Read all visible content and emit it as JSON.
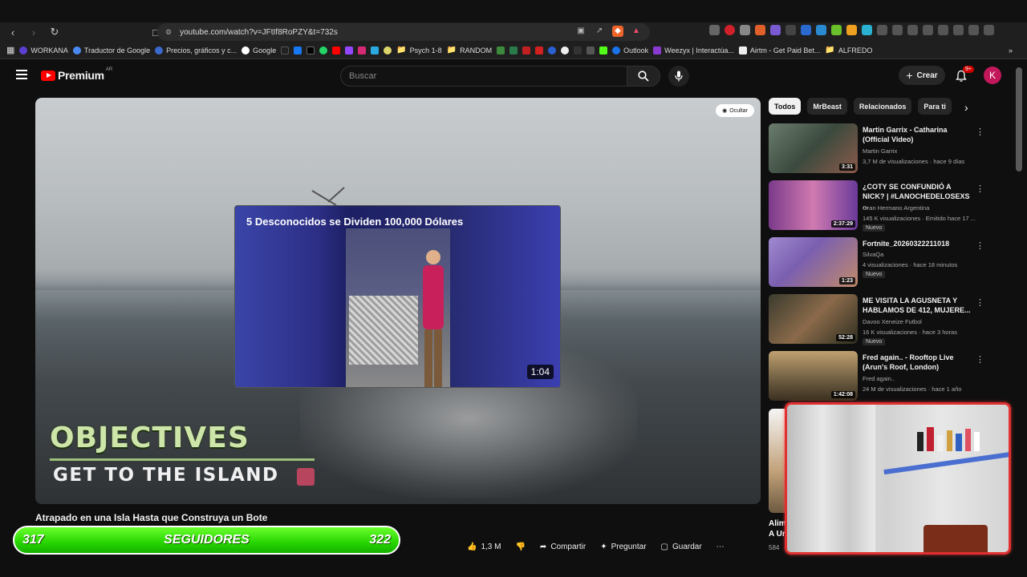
{
  "browser": {
    "url": "youtube.com/watch?v=JFtIf8RoPZY&t=732s",
    "bookmarks": [
      "WORKANA",
      "Traductor de Google",
      "Precios, gráficos y c...",
      "Google",
      "Psych 1-8",
      "RANDOM",
      "Outlook",
      "Weezyx | Interactúa...",
      "Airtm - Get Paid Bet...",
      "ALFREDO"
    ]
  },
  "masthead": {
    "logo_text": "Premium",
    "country": "AR",
    "search_placeholder": "Buscar",
    "create_label": "Crear",
    "notif_count": "9+",
    "avatar_letter": "K"
  },
  "player": {
    "hide_label": "Ocultar",
    "card_title": "5 Desconocidos se Dividen 100,000 Dólares",
    "card_duration": "1:04",
    "overlay_line1": "OBJECTIVES",
    "overlay_line2": "GET TO THE ISLAND"
  },
  "video": {
    "title": "Atrapado en una Isla Hasta que Construya un Bote",
    "likes": "1,3 M",
    "share_label": "Compartir",
    "ask_label": "Preguntar",
    "save_label": "Guardar"
  },
  "followers_bar": {
    "left": "317",
    "label": "SEGUIDORES",
    "right": "322"
  },
  "chips": [
    "Todos",
    "MrBeast",
    "Relacionados",
    "Para ti"
  ],
  "recommendations": [
    {
      "title": "Martin Garrix - Catharina (Official Video)",
      "channel": "Martin Garrix",
      "meta": "3,7 M de visualizaciones · hace 9 días",
      "duration": "3:31",
      "new": ""
    },
    {
      "title": "¿COTY SE CONFUNDIÓ A NICK? | #LANOCHEDELOSEXS ...",
      "channel": "Gran Hermano Argentina",
      "meta": "145 K visualizaciones · Emitido hace 17 ...",
      "duration": "2:37:29",
      "new": "Nuevo"
    },
    {
      "title": "Fortnite_20260322211018",
      "channel": "SilvaQa",
      "meta": "4 visualizaciones · hace 18 minutos",
      "duration": "1:23",
      "new": "Nuevo"
    },
    {
      "title": "ME VISITA LA AGUSNETA Y HABLAMOS DE 412, MUJERE...",
      "channel": "Davoo Xeneize Futbol",
      "meta": "16 K visualizaciones · hace 3 horas",
      "duration": "52:28",
      "new": "Nuevo"
    },
    {
      "title": "Fred again.. - Rooftop Live (Arun's Roof, London)",
      "channel": "Fred again..",
      "meta": "24 M de visualizaciones · hace 1 año",
      "duration": "1:42:08",
      "new": ""
    }
  ],
  "partial_rec": {
    "title_line1": "Alim",
    "title_line2": "A Ur",
    "meta": "584"
  },
  "thumb_colors": [
    "#5b6d5e",
    "#7a3a8a",
    "#8a5fb0",
    "#3b3b2e",
    "#6b5b40"
  ],
  "thumb_overlays": [
    "",
    "HABLÓ LA EX DE",
    "",
    "CHARLA CON AGUSN",
    ""
  ]
}
